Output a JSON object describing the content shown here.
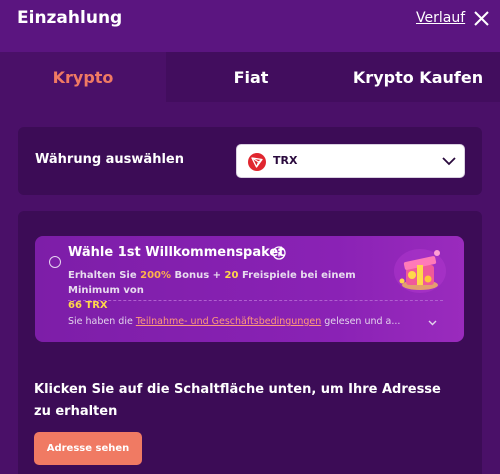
{
  "header": {
    "title": "Einzahlung",
    "history_label": "Verlauf"
  },
  "tabs": [
    {
      "label": "Krypto",
      "active": true
    },
    {
      "label": "Fiat",
      "active": false
    },
    {
      "label": "Krypto Kaufen",
      "active": false
    }
  ],
  "currency": {
    "label": "Währung auswählen",
    "selected": "TRX"
  },
  "bonus": {
    "title": "Wähle 1st Willkommenspaket",
    "desc_prefix": "Erhalten Sie ",
    "bonus_percent": "200%",
    "desc_mid1": " Bonus + ",
    "free_spins": "20",
    "desc_mid2": " Freispiele bei einem Minimum von",
    "minimum": "66 TRX",
    "terms_prefix": "Sie haben die ",
    "terms_link": "Teilnahme- und Geschäftsbedingungen",
    "terms_suffix": " gelesen und a..."
  },
  "instruction": "Klicken Sie auf die Schaltfläche unten, um Ihre Adresse zu erhalten",
  "address_button": "Adresse sehen",
  "colors": {
    "accent": "#f07a63",
    "background": "#4a1068",
    "panel": "#3c0c56",
    "bonus_card": "#8a22b5",
    "highlight_orange": "#ffb24a",
    "highlight_yellow": "#ffd84a"
  },
  "icons": [
    "close-icon",
    "trx-logo-icon",
    "chevron-down-icon",
    "info-icon",
    "gift-icon",
    "radio-icon"
  ]
}
